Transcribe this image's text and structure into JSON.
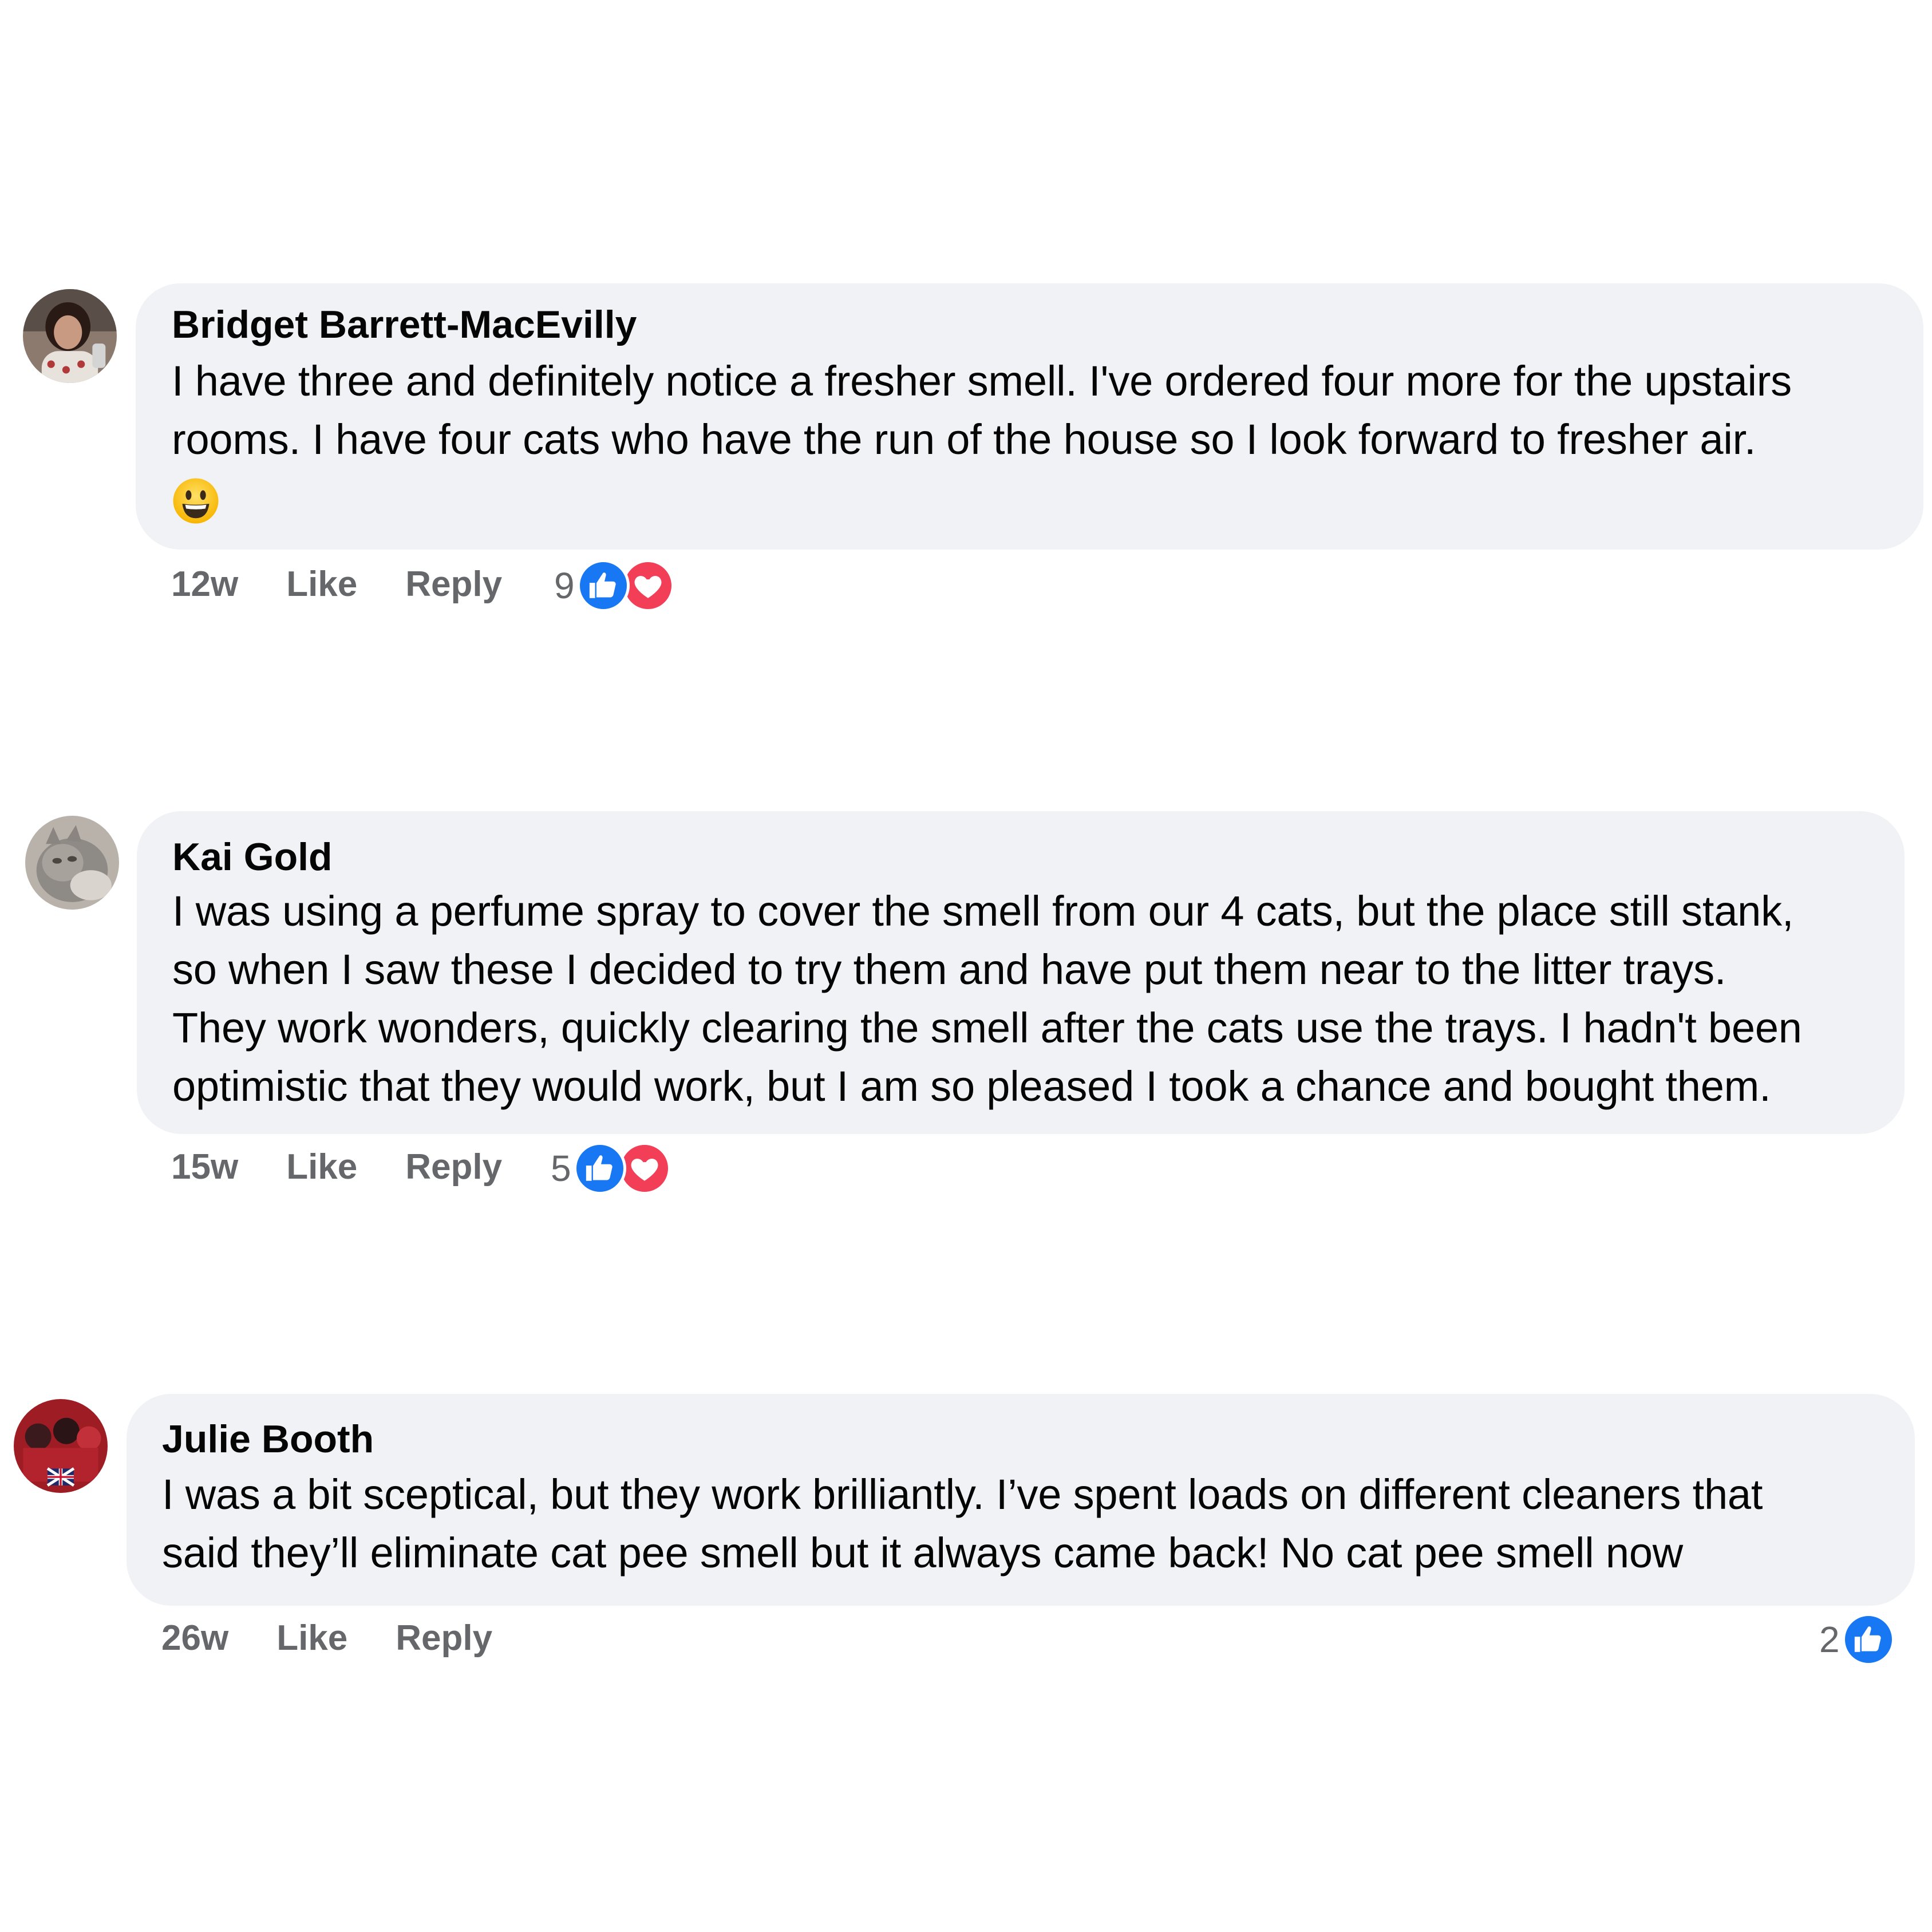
{
  "comments": [
    {
      "author": "Bridget Barrett-MacEvilly",
      "lines": [
        "I have three and definitely notice a fresher smell. I've ordered four more for the upstairs",
        "rooms. I have four cats who have the run of the house so I look forward to fresher air."
      ],
      "emoji": "grinning-face",
      "time": "12w",
      "like_label": "Like",
      "reply_label": "Reply",
      "reaction_count": "9",
      "reactions": [
        "like",
        "love"
      ]
    },
    {
      "author": "Kai Gold",
      "lines": [
        "I was using a perfume spray to cover the smell from our 4 cats, but the place still stank,",
        "so when I saw these I decided to try them and have put them near to the litter trays.",
        "They work wonders, quickly clearing the smell after the cats use the trays. I hadn't been",
        "optimistic that they would work, but I am so pleased I took a chance and bought them."
      ],
      "time": "15w",
      "like_label": "Like",
      "reply_label": "Reply",
      "reaction_count": "5",
      "reactions": [
        "like",
        "love"
      ]
    },
    {
      "author": "Julie Booth",
      "lines": [
        "I was a bit sceptical, but they work brilliantly. I’ve spent loads on different cleaners that",
        "said they’ll eliminate cat pee smell but it always came back! No cat pee smell now"
      ],
      "time": "26w",
      "like_label": "Like",
      "reply_label": "Reply",
      "reaction_count": "2",
      "reactions": [
        "like"
      ]
    }
  ],
  "colors": {
    "bubble": "#f0f2f5",
    "meta_text": "#65676b",
    "like_blue": "#1877f2",
    "love_red": "#f33e58"
  }
}
